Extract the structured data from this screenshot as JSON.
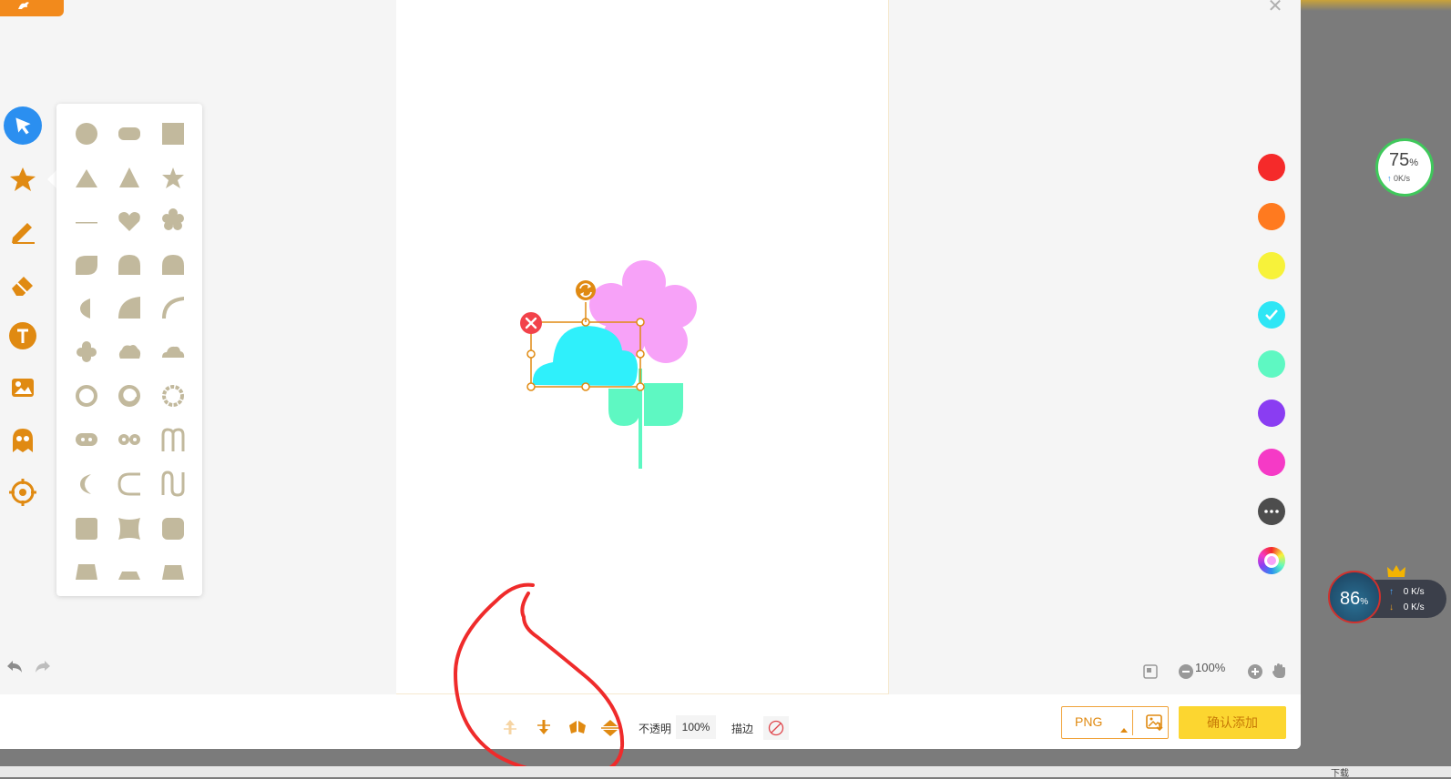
{
  "window": {
    "close_icon": "close-icon",
    "badge_icon": "app-logo-icon"
  },
  "toolbar_left": {
    "tools": [
      {
        "name": "select-tool",
        "icon": "cursor-icon",
        "active": true
      },
      {
        "name": "shape-tool",
        "icon": "star-icon"
      },
      {
        "name": "pencil-tool",
        "icon": "pencil-icon"
      },
      {
        "name": "eraser-tool",
        "icon": "eraser-icon"
      },
      {
        "name": "text-tool",
        "icon": "text-icon"
      },
      {
        "name": "image-tool",
        "icon": "image-icon"
      },
      {
        "name": "sticker-tool",
        "icon": "ghost-icon"
      },
      {
        "name": "target-tool",
        "icon": "target-icon"
      }
    ],
    "undo_icon": "undo-icon",
    "redo_icon": "redo-icon"
  },
  "shape_panel": {
    "shape_color": "#c2b99d",
    "rows": 11,
    "shapes": [
      "circle",
      "rounded-rect",
      "square",
      "triangle",
      "triangle-tall",
      "star",
      "line",
      "heart",
      "flower",
      "leaf-square",
      "drop-left",
      "arch",
      "half-circle",
      "quarter-circle",
      "arc",
      "cross",
      "cloud",
      "cloud-flat",
      "ring",
      "ring-notch",
      "ring-dashed",
      "capsule-dots",
      "infinity",
      "m-shape",
      "crescent",
      "c-shape",
      "wave-n",
      "rounded-square",
      "concave-square",
      "squircle",
      "trapezoid",
      "trapezoid-low",
      "trapezoid-wide"
    ]
  },
  "canvas": {
    "selected_shape_color": "#2ff0fb",
    "flower_color": "#f7a2f8",
    "leaf_color": "#5ef8c2",
    "selection_color": "#e08a12",
    "delete_color": "#f2424a"
  },
  "palette": {
    "colors": [
      "#f52a2a",
      "#ff7a1f",
      "#f7f23a",
      "#2ee6f5",
      "#5ef8c2",
      "#8a3df2",
      "#f53ac6"
    ],
    "selected_index": 3,
    "more_icon": "more-dots-icon",
    "picker_icon": "color-wheel-icon"
  },
  "zoom": {
    "value": "100%",
    "minus_icon": "zoom-out-icon",
    "plus_icon": "zoom-in-icon",
    "hand_icon": "hand-icon",
    "fit_icon": "fit-icon"
  },
  "bottombar": {
    "arrange_icons": [
      "bring-forward-icon",
      "send-backward-icon",
      "flip-horizontal-icon",
      "flip-vertical-icon"
    ],
    "opacity_label": "不透明",
    "opacity_value": "100%",
    "stroke_label": "描边",
    "stroke_icon": "no-stroke-icon",
    "format": "PNG",
    "export_icon": "export-image-icon",
    "confirm_label": "确认添加"
  },
  "widgets": {
    "speed_percent": "75",
    "speed_unit": "%",
    "speed_rate": "0K/s",
    "mem_percent": "86",
    "mem_unit": "%",
    "up_rate": "0 K/s",
    "down_rate": "0 K/s"
  },
  "taskbar": {
    "download_label": "下载"
  }
}
